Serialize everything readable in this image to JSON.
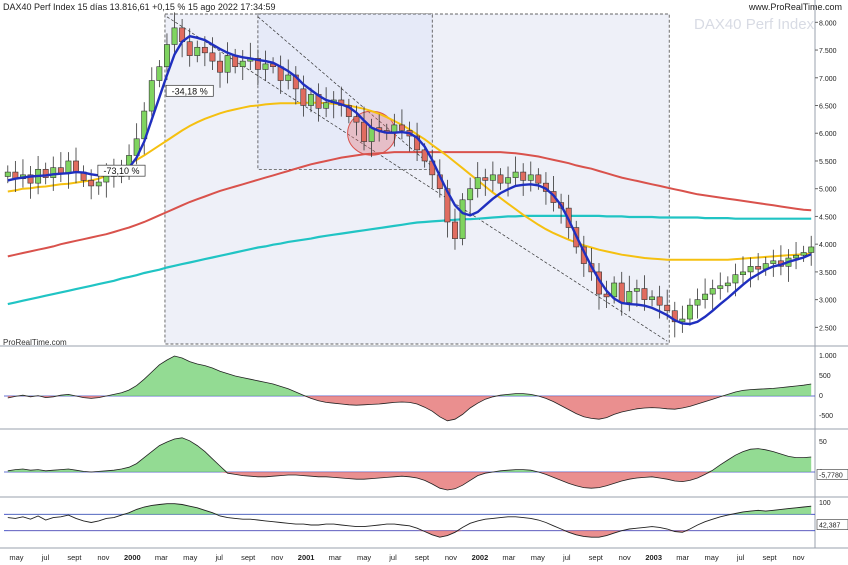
{
  "header": {
    "title": "DAX40 Perf Index 15 días 13.816,61 +0,15 % 15 ago 2022 17:34:59",
    "brand": "www.ProRealTime.com",
    "watermark": "DAX40 Perf Index",
    "credit": "ProRealTime.com"
  },
  "colors": {
    "up_candle": "#7fd460",
    "down_candle": "#e06c60",
    "ma_blue": "#1f2fbf",
    "ma_yellow": "#f5c010",
    "ma_red": "#d9524c",
    "ma_teal": "#20c4c4",
    "osc_pos": "#6fcf6f",
    "osc_neg": "#e36a6a",
    "ref_line": "#3340c0"
  },
  "chart_data": [
    {
      "type": "candlestick",
      "name": "price",
      "y_axis_ticks": [
        "8.000",
        "7.500",
        "7.000",
        "6.500",
        "6.000",
        "5.500",
        "5.000",
        "4.500",
        "4.000",
        "3.500",
        "3.000",
        "2.500"
      ],
      "ylim": [
        2200,
        8150
      ],
      "x_ticks": [
        "may",
        "jul",
        "sept",
        "nov",
        "2000",
        "mar",
        "may",
        "jul",
        "sept",
        "nov",
        "2001",
        "mar",
        "may",
        "jul",
        "sept",
        "nov",
        "2002",
        "mar",
        "may",
        "jul",
        "sept",
        "nov",
        "2003",
        "mar",
        "may",
        "jul",
        "sept",
        "nov"
      ],
      "closes": [
        5300,
        5180,
        5250,
        5100,
        5350,
        5200,
        5380,
        5280,
        5500,
        5300,
        5150,
        5050,
        5120,
        5300,
        5220,
        5400,
        5600,
        5900,
        6400,
        6950,
        7200,
        7600,
        7900,
        7650,
        7400,
        7550,
        7450,
        7300,
        7100,
        7400,
        7200,
        7300,
        7350,
        7150,
        7250,
        7200,
        6950,
        7050,
        6800,
        6500,
        6700,
        6450,
        6550,
        6600,
        6500,
        6300,
        6200,
        5850,
        6100,
        6050,
        6000,
        6150,
        6050,
        5950,
        5700,
        5500,
        5250,
        5000,
        4400,
        4100,
        4800,
        5000,
        5200,
        5150,
        5250,
        5100,
        5200,
        5300,
        5150,
        5250,
        5100,
        4950,
        4750,
        4650,
        4300,
        3950,
        3650,
        3500,
        3100,
        3050,
        3300,
        2950,
        3150,
        3200,
        3000,
        3050,
        2900,
        2800,
        2600,
        2650,
        2900,
        3000,
        3100,
        3200,
        3250,
        3300,
        3450,
        3500,
        3600,
        3550,
        3650,
        3700,
        3600,
        3750,
        3800,
        3850,
        3950
      ],
      "annotations": [
        "-34,18 %",
        "-73,10 %"
      ],
      "moving_averages": {
        "blue_fast": [
          5150,
          5180,
          5200,
          5220,
          5230,
          5240,
          5260,
          5270,
          5280,
          5300,
          5290,
          5260,
          5240,
          5250,
          5270,
          5300,
          5380,
          5560,
          5850,
          6250,
          6650,
          7050,
          7420,
          7650,
          7750,
          7720,
          7680,
          7600,
          7520,
          7450,
          7400,
          7370,
          7350,
          7320,
          7300,
          7270,
          7200,
          7120,
          7020,
          6880,
          6780,
          6680,
          6600,
          6560,
          6520,
          6470,
          6370,
          6230,
          6100,
          6040,
          6010,
          6010,
          6020,
          6000,
          5920,
          5760,
          5520,
          5230,
          4950,
          4700,
          4560,
          4520,
          4580,
          4700,
          4820,
          4920,
          4990,
          5050,
          5070,
          5080,
          5060,
          5000,
          4880,
          4700,
          4440,
          4150,
          3870,
          3600,
          3360,
          3160,
          3020,
          2940,
          2920,
          2910,
          2890,
          2850,
          2790,
          2720,
          2630,
          2570,
          2560,
          2600,
          2690,
          2800,
          2920,
          3030,
          3150,
          3270,
          3380,
          3460,
          3540,
          3600,
          3630,
          3680,
          3720,
          3760,
          3820
        ],
        "yellow_mid": [
          4950,
          4970,
          5000,
          5010,
          5030,
          5040,
          5060,
          5080,
          5090,
          5110,
          5130,
          5150,
          5180,
          5230,
          5290,
          5360,
          5440,
          5520,
          5600,
          5690,
          5780,
          5870,
          5960,
          6050,
          6130,
          6200,
          6260,
          6310,
          6360,
          6400,
          6430,
          6460,
          6490,
          6500,
          6520,
          6530,
          6540,
          6540,
          6540,
          6550,
          6550,
          6550,
          6540,
          6530,
          6520,
          6500,
          6470,
          6440,
          6400,
          6350,
          6290,
          6220,
          6150,
          6070,
          5980,
          5890,
          5790,
          5690,
          5590,
          5480,
          5370,
          5260,
          5150,
          5040,
          4930,
          4830,
          4730,
          4630,
          4530,
          4440,
          4350,
          4270,
          4200,
          4140,
          4080,
          4030,
          3980,
          3940,
          3900,
          3870,
          3840,
          3810,
          3790,
          3770,
          3750,
          3740,
          3730,
          3720,
          3720,
          3720,
          3720,
          3720,
          3720,
          3720,
          3720,
          3720,
          3730,
          3740,
          3750,
          3760,
          3770,
          3780,
          3790,
          3800,
          3810,
          3820,
          3830
        ],
        "red_slow": [
          3780,
          3810,
          3840,
          3870,
          3900,
          3930,
          3960,
          4000,
          4030,
          4060,
          4090,
          4120,
          4150,
          4180,
          4220,
          4260,
          4300,
          4350,
          4400,
          4460,
          4520,
          4580,
          4640,
          4700,
          4760,
          4810,
          4860,
          4910,
          4960,
          5000,
          5040,
          5080,
          5120,
          5160,
          5200,
          5240,
          5280,
          5320,
          5360,
          5400,
          5440,
          5470,
          5500,
          5530,
          5560,
          5580,
          5600,
          5620,
          5630,
          5640,
          5650,
          5660,
          5660,
          5660,
          5660,
          5660,
          5660,
          5660,
          5660,
          5660,
          5660,
          5660,
          5660,
          5660,
          5660,
          5660,
          5650,
          5640,
          5620,
          5600,
          5580,
          5550,
          5520,
          5490,
          5460,
          5420,
          5390,
          5360,
          5320,
          5280,
          5240,
          5200,
          5170,
          5140,
          5110,
          5080,
          5050,
          5020,
          4990,
          4960,
          4930,
          4900,
          4880,
          4860,
          4840,
          4820,
          4800,
          4780,
          4760,
          4740,
          4720,
          4700,
          4680,
          4660,
          4640,
          4620,
          4610
        ],
        "teal_slowest": [
          2920,
          2950,
          2980,
          3010,
          3040,
          3070,
          3100,
          3130,
          3160,
          3190,
          3220,
          3250,
          3280,
          3310,
          3340,
          3380,
          3410,
          3440,
          3480,
          3510,
          3540,
          3580,
          3610,
          3640,
          3670,
          3700,
          3730,
          3760,
          3790,
          3820,
          3850,
          3880,
          3910,
          3940,
          3960,
          3990,
          4010,
          4040,
          4060,
          4080,
          4100,
          4130,
          4150,
          4170,
          4190,
          4210,
          4230,
          4250,
          4270,
          4290,
          4310,
          4330,
          4350,
          4370,
          4390,
          4400,
          4410,
          4420,
          4430,
          4440,
          4450,
          4450,
          4460,
          4470,
          4480,
          4490,
          4500,
          4500,
          4510,
          4510,
          4510,
          4510,
          4510,
          4510,
          4510,
          4510,
          4510,
          4510,
          4510,
          4500,
          4500,
          4500,
          4490,
          4490,
          4490,
          4490,
          4480,
          4480,
          4480,
          4480,
          4480,
          4480,
          4470,
          4470,
          4470,
          4470,
          4460,
          4460,
          4460,
          4460,
          4460,
          4460,
          4460,
          4460,
          4460,
          4460,
          4460
        ]
      }
    },
    {
      "type": "area",
      "name": "oscillator_1",
      "y_axis_ticks": [
        "1.000",
        "500",
        "0",
        "-500"
      ],
      "ylim": [
        -800,
        1200
      ],
      "values": [
        -50,
        -10,
        20,
        -20,
        10,
        -40,
        -20,
        20,
        40,
        0,
        -40,
        -60,
        -40,
        0,
        40,
        80,
        150,
        260,
        420,
        600,
        780,
        900,
        1000,
        950,
        860,
        800,
        760,
        700,
        620,
        560,
        500,
        460,
        420,
        380,
        340,
        300,
        240,
        180,
        100,
        20,
        -60,
        -120,
        -160,
        -180,
        -200,
        -220,
        -230,
        -220,
        -210,
        -200,
        -180,
        -160,
        -150,
        -160,
        -200,
        -280,
        -380,
        -520,
        -620,
        -580,
        -460,
        -300,
        -180,
        -80,
        -20,
        20,
        40,
        60,
        60,
        40,
        0,
        -60,
        -140,
        -240,
        -340,
        -440,
        -520,
        -560,
        -580,
        -540,
        -460,
        -400,
        -360,
        -320,
        -300,
        -290,
        -300,
        -320,
        -330,
        -300,
        -260,
        -200,
        -140,
        -80,
        -20,
        40,
        100,
        140,
        160,
        170,
        180,
        190,
        210,
        230,
        250,
        270,
        300
      ]
    },
    {
      "type": "area",
      "name": "oscillator_2",
      "y_axis_ticks": [
        "50",
        "0",
        "-5,7780"
      ],
      "ylim": [
        -40,
        70
      ],
      "values": [
        2,
        4,
        5,
        3,
        4,
        2,
        3,
        4,
        5,
        3,
        1,
        0,
        1,
        2,
        3,
        5,
        8,
        14,
        24,
        34,
        44,
        50,
        55,
        57,
        52,
        44,
        34,
        22,
        10,
        -2,
        -4,
        -6,
        -7,
        -8,
        -8,
        -7,
        -6,
        -5,
        -5,
        -6,
        -7,
        -8,
        -8,
        -9,
        -10,
        -11,
        -12,
        -12,
        -11,
        -10,
        -9,
        -8,
        -7,
        -8,
        -10,
        -14,
        -20,
        -27,
        -30,
        -28,
        -22,
        -14,
        -6,
        -2,
        0,
        2,
        3,
        4,
        4,
        3,
        0,
        -4,
        -9,
        -14,
        -19,
        -23,
        -26,
        -27,
        -26,
        -23,
        -19,
        -15,
        -12,
        -10,
        -9,
        -8,
        -10,
        -12,
        -15,
        -16,
        -14,
        -10,
        -4,
        3,
        12,
        20,
        28,
        34,
        38,
        39,
        37,
        34,
        30,
        26,
        24,
        24,
        25
      ]
    },
    {
      "type": "line",
      "name": "oscillator_3",
      "y_axis_ticks": [
        "100",
        "42,387"
      ],
      "ylim": [
        -10,
        110
      ],
      "values": [
        62,
        60,
        64,
        58,
        66,
        56,
        62,
        64,
        68,
        60,
        54,
        50,
        54,
        60,
        62,
        68,
        74,
        82,
        88,
        92,
        94,
        96,
        96,
        94,
        90,
        86,
        80,
        74,
        66,
        62,
        60,
        58,
        58,
        56,
        54,
        52,
        50,
        48,
        46,
        46,
        44,
        44,
        46,
        46,
        44,
        42,
        40,
        40,
        42,
        44,
        46,
        46,
        44,
        42,
        36,
        28,
        20,
        14,
        18,
        26,
        38,
        48,
        54,
        58,
        60,
        62,
        64,
        64,
        62,
        60,
        56,
        50,
        42,
        34,
        26,
        20,
        16,
        14,
        14,
        18,
        24,
        30,
        34,
        36,
        38,
        40,
        38,
        34,
        28,
        26,
        34,
        44,
        52,
        58,
        64,
        68,
        72,
        76,
        78,
        80,
        78,
        80,
        82,
        84,
        86,
        88,
        90
      ],
      "overbought_line": 70,
      "oversold_line": 30
    }
  ]
}
